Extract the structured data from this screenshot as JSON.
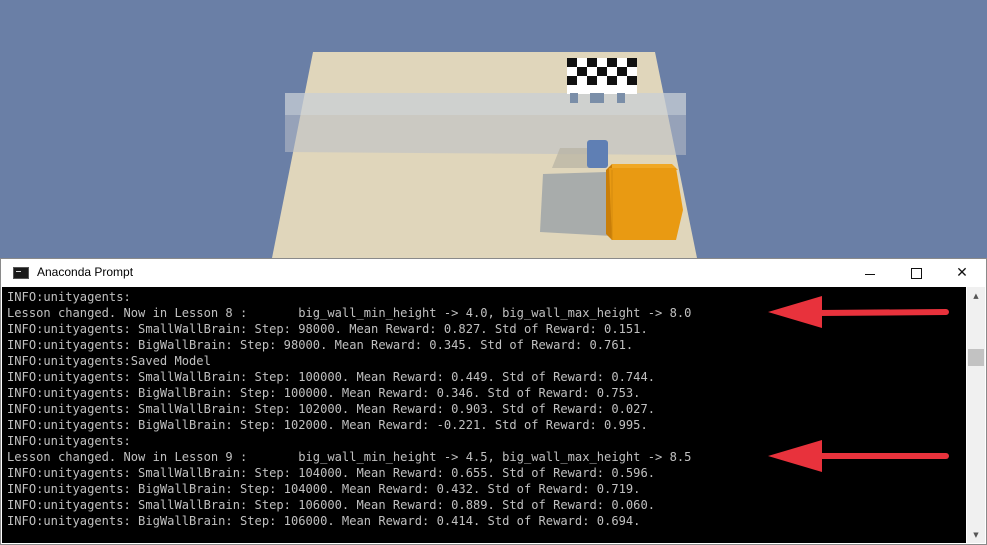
{
  "window": {
    "title": "Anaconda Prompt",
    "icon": "console-icon",
    "controls": {
      "minimize_icon": "minimize-icon",
      "maximize_icon": "maximize-icon",
      "close_label": "✕"
    }
  },
  "console": {
    "lines": [
      "INFO:unityagents:",
      "Lesson changed. Now in Lesson 8 :       big_wall_min_height -> 4.0, big_wall_max_height -> 8.0",
      "INFO:unityagents: SmallWallBrain: Step: 98000. Mean Reward: 0.827. Std of Reward: 0.151.",
      "INFO:unityagents: BigWallBrain: Step: 98000. Mean Reward: 0.345. Std of Reward: 0.761.",
      "INFO:unityagents:Saved Model",
      "INFO:unityagents: SmallWallBrain: Step: 100000. Mean Reward: 0.449. Std of Reward: 0.744.",
      "INFO:unityagents: BigWallBrain: Step: 100000. Mean Reward: 0.346. Std of Reward: 0.753.",
      "INFO:unityagents: SmallWallBrain: Step: 102000. Mean Reward: 0.903. Std of Reward: 0.027.",
      "INFO:unityagents: BigWallBrain: Step: 102000. Mean Reward: -0.221. Std of Reward: 0.995.",
      "INFO:unityagents:",
      "Lesson changed. Now in Lesson 9 :       big_wall_min_height -> 4.5, big_wall_max_height -> 8.5",
      "INFO:unityagents: SmallWallBrain: Step: 104000. Mean Reward: 0.655. Std of Reward: 0.596.",
      "INFO:unityagents: BigWallBrain: Step: 104000. Mean Reward: 0.432. Std of Reward: 0.719.",
      "INFO:unityagents: SmallWallBrain: Step: 106000. Mean Reward: 0.889. Std of Reward: 0.060.",
      "INFO:unityagents: BigWallBrain: Step: 106000. Mean Reward: 0.414. Std of Reward: 0.694."
    ],
    "text_color": "#c0c0c0",
    "background": "#000000"
  },
  "annotations": {
    "arrow_color": "#e8323c"
  },
  "scene": {
    "sky_color": "#6a7fa6",
    "floor_color": "#e0d6bb",
    "agent_color": "#5f7fb4",
    "block_color": "#e99a12",
    "goal_pattern": "checkerboard"
  }
}
